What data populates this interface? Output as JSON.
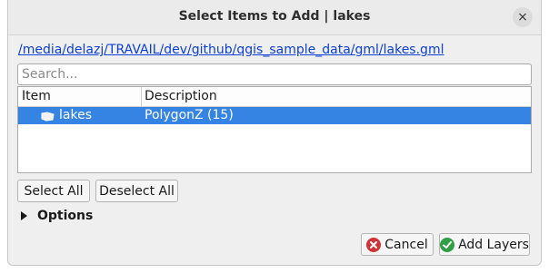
{
  "dialog": {
    "title": "Select Items to Add | lakes",
    "close_label": "×",
    "path_link": "/media/delazj/TRAVAIL/dev/github/qgis_sample_data/gml/lakes.gml"
  },
  "search": {
    "placeholder": "Search..."
  },
  "tree": {
    "columns": [
      "Item",
      "Description"
    ],
    "rows": [
      {
        "item": "lakes",
        "description": "PolygonZ (15)",
        "selected": true
      }
    ]
  },
  "selection_buttons": {
    "select_all": "Select All",
    "deselect_all": "Deselect All"
  },
  "options": {
    "label": "Options",
    "expanded": false
  },
  "footer": {
    "cancel_label": "Cancel",
    "add_layers_label": "Add Layers"
  },
  "colors": {
    "selection": "#3584e4",
    "link": "#0b3fd6",
    "cancel_icon": "#d13438",
    "add_icon": "#2f9e44"
  },
  "icons": {
    "close": "close-icon",
    "layer": "polygon-layer-icon",
    "expand": "triangle-right-icon",
    "cancel": "cancel-icon",
    "add": "check-icon"
  }
}
